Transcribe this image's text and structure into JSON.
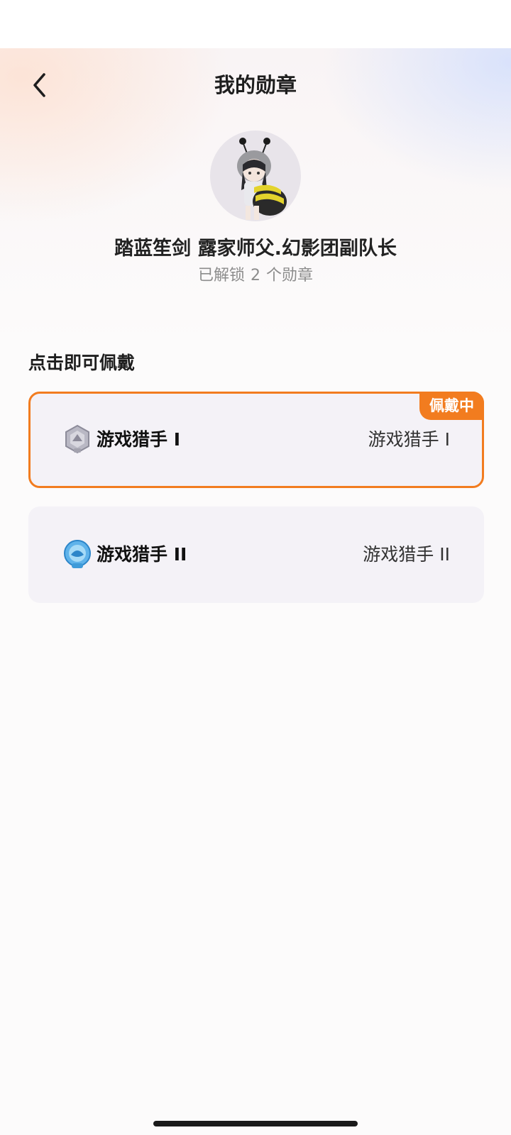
{
  "header": {
    "title": "我的勋章",
    "back_icon": "chevron-left-icon"
  },
  "profile": {
    "name": "踏蓝笙剑 露家师父.幻影团副队长",
    "unlocked_prefix": "已解锁",
    "unlocked_count": "2",
    "unlocked_suffix": "个勋章"
  },
  "section": {
    "title": "点击即可佩戴"
  },
  "badges": [
    {
      "name": "游戏猎手 I",
      "level": "游戏猎手 I",
      "tag": "佩戴中",
      "icon": "silver-badge-icon"
    },
    {
      "name": "游戏猎手 II",
      "level": "游戏猎手 II",
      "icon": "blue-badge-icon"
    }
  ],
  "colors": {
    "accent": "#f27c1f",
    "card_bg": "#f4f2f7"
  }
}
